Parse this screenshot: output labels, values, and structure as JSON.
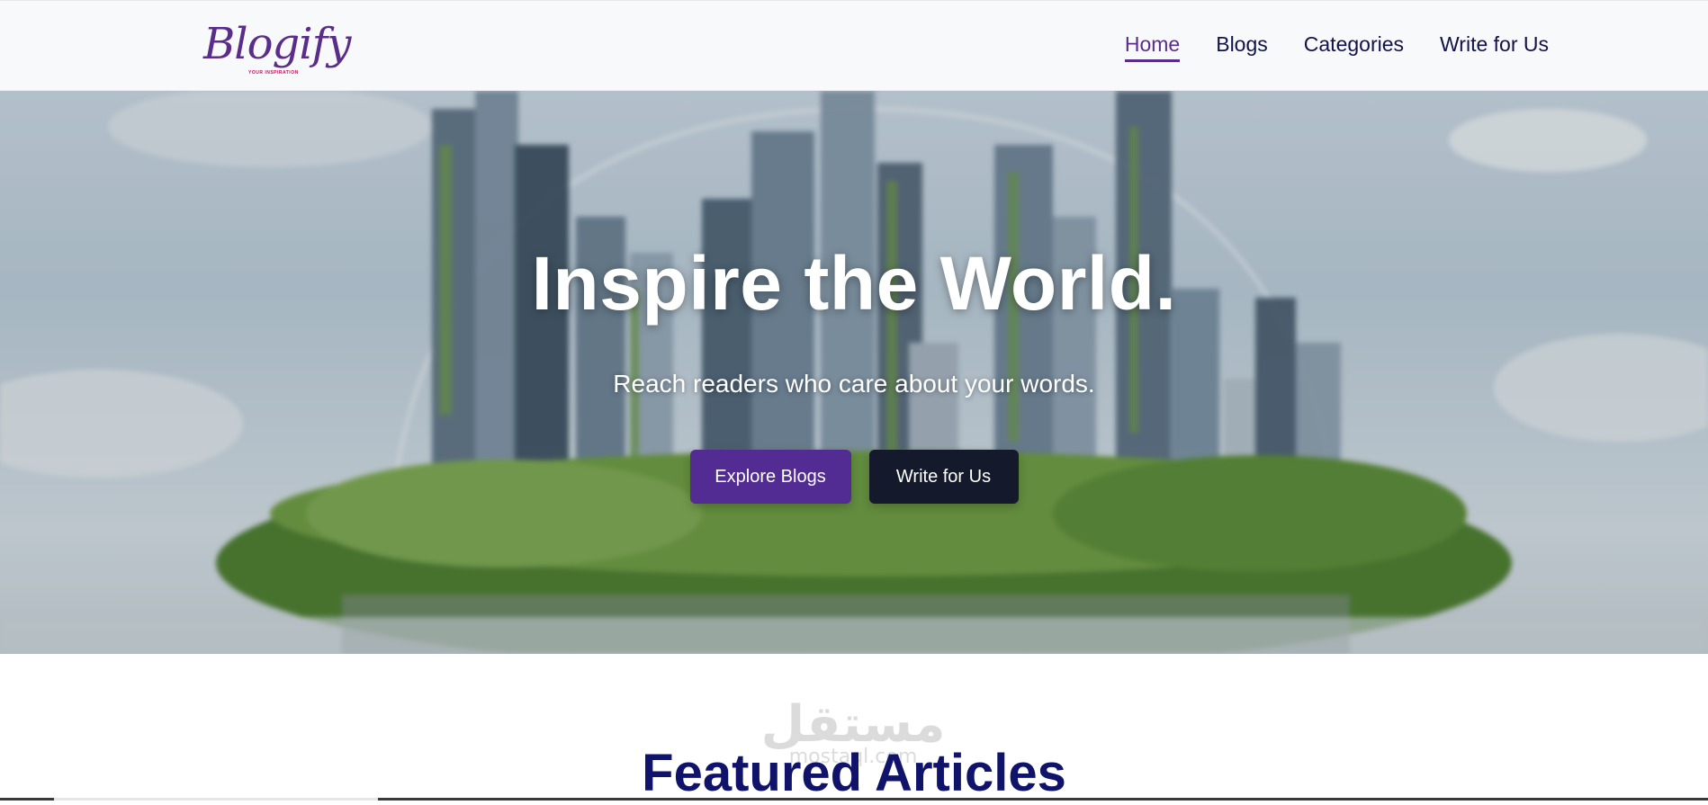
{
  "header": {
    "logo": {
      "wordmark": "Blogify",
      "tagline": "YOUR INSPIRATION"
    },
    "nav": [
      {
        "label": "Home",
        "active": true
      },
      {
        "label": "Blogs",
        "active": false
      },
      {
        "label": "Categories",
        "active": false
      },
      {
        "label": "Write for Us",
        "active": false
      }
    ]
  },
  "hero": {
    "title": "Inspire the World.",
    "subtitle": "Reach readers who care about your words.",
    "primary_button": "Explore Blogs",
    "secondary_button": "Write for Us"
  },
  "featured": {
    "title": "Featured Articles"
  },
  "watermark": {
    "arabic": "مستقل",
    "latin": "mostaql.com"
  },
  "colors": {
    "brand": "#5b2d8a",
    "nav_text": "#101248",
    "primary_button": "#532c93",
    "dark_button": "#141a2b",
    "heading": "#10136a"
  }
}
